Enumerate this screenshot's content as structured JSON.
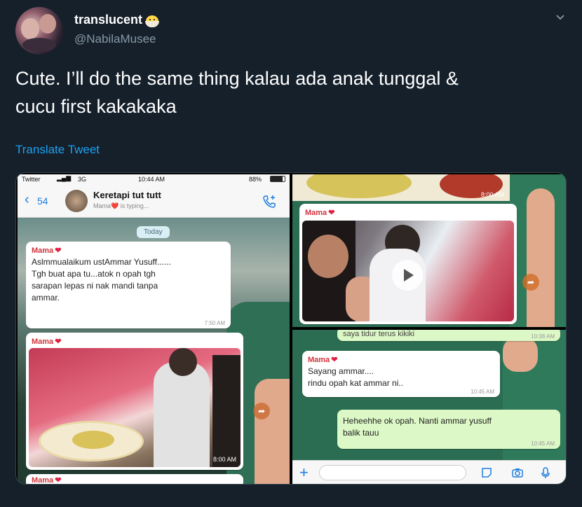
{
  "tweet": {
    "display_name": "translucent",
    "handle": "@NabilaMusee",
    "text_line1": "Cute. I’ll do the same thing kalau ada anak tunggal &",
    "text_line2": "cucu first kakakaka",
    "translate_label": "Translate Tweet"
  },
  "colors": {
    "background": "#15202b",
    "link": "#1da1f2",
    "muted": "#8899a6",
    "whatsapp_blue": "#1e7ee0",
    "sender_red": "#d0343b"
  },
  "icons": [
    "chick-emoji-icon",
    "chevron-down-icon",
    "back-chevron-icon",
    "add-call-icon",
    "heart-icon",
    "forward-icon",
    "play-icon",
    "plus-icon",
    "sticker-icon",
    "camera-icon",
    "microphone-icon"
  ],
  "chat": {
    "status": {
      "carrier": "Twitter",
      "network": "3G",
      "time": "10:44 AM",
      "battery": "88%"
    },
    "back_count": "54",
    "title": "Keretapi tut tutt",
    "subtitle": "Mama❤️ is typing...",
    "date_chip": "Today",
    "sender": "Mama",
    "messages": [
      {
        "line1": "Aslmmualaikum ustAmmar Yusuff......",
        "line2": "Tgh buat apa tu...atok n opah tgh",
        "line3": "sarapan lepas ni nak mandi tanpa",
        "line4": "ammar.",
        "time": "7:50 AM"
      },
      {
        "time": "8:00 AM"
      },
      {
        "time": "8:00 AM"
      },
      {
        "partial": "saya tidur terus kikiki",
        "time": "10:38 AM"
      },
      {
        "line1": "Sayang ammar....",
        "line2": "rindu opah kat ammar ni..",
        "time": "10:45 AM"
      },
      {
        "line1": "Heheehhe ok opah. Nanti ammar yusuff",
        "line2": "balik tauu",
        "time": "10:45 AM"
      }
    ]
  }
}
